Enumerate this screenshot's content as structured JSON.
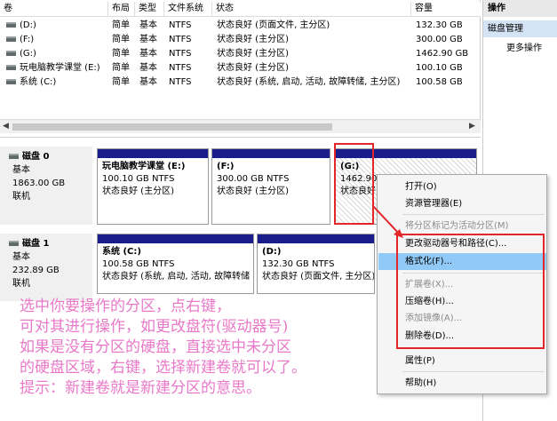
{
  "columns": [
    "卷",
    "布局",
    "类型",
    "文件系统",
    "状态",
    "容量"
  ],
  "volumes": [
    {
      "name": "(D:)",
      "layout": "简单",
      "type": "基本",
      "fs": "NTFS",
      "status": "状态良好 (页面文件, 主分区)",
      "capacity": "132.30 GB"
    },
    {
      "name": "(F:)",
      "layout": "简单",
      "type": "基本",
      "fs": "NTFS",
      "status": "状态良好 (主分区)",
      "capacity": "300.00 GB"
    },
    {
      "name": "(G:)",
      "layout": "简单",
      "type": "基本",
      "fs": "NTFS",
      "status": "状态良好 (主分区)",
      "capacity": "1462.90 GB"
    },
    {
      "name": "玩电脑教学课堂 (E:)",
      "layout": "简单",
      "type": "基本",
      "fs": "NTFS",
      "status": "状态良好 (主分区)",
      "capacity": "100.10 GB"
    },
    {
      "name": "系统 (C:)",
      "layout": "简单",
      "type": "基本",
      "fs": "NTFS",
      "status": "状态良好 (系统, 启动, 活动, 故障转储, 主分区)",
      "capacity": "100.58 GB"
    }
  ],
  "actions": {
    "title": "操作",
    "section": "磁盘管理",
    "more": "更多操作"
  },
  "disks": [
    {
      "name": "磁盘 0",
      "type": "基本",
      "size": "1863.00 GB",
      "state": "联机",
      "partitions": [
        {
          "label": "玩电脑教学课堂 (E:)",
          "size": "100.10 GB NTFS",
          "status": "状态良好 (主分区)"
        },
        {
          "label": "(F:)",
          "size": "300.00 GB NTFS",
          "status": "状态良好 (主分区)"
        },
        {
          "label": "(G:)",
          "size": "1462.90",
          "status": "状态良好"
        }
      ]
    },
    {
      "name": "磁盘 1",
      "type": "基本",
      "size": "232.89 GB",
      "state": "联机",
      "partitions": [
        {
          "label": "系统 (C:)",
          "size": "100.58 GB NTFS",
          "status": "状态良好 (系统, 启动, 活动, 故障转储"
        },
        {
          "label": "(D:)",
          "size": "132.30 GB NTFS",
          "status": "状态良好 (页面文件, 主分区)"
        }
      ]
    }
  ],
  "context_menu": [
    {
      "label": "打开(O)",
      "enabled": true
    },
    {
      "label": "资源管理器(E)",
      "enabled": true
    },
    {
      "label": "将分区标记为活动分区(M)",
      "enabled": false
    },
    {
      "label": "更改驱动器号和路径(C)...",
      "enabled": true
    },
    {
      "label": "格式化(F)...",
      "enabled": true,
      "highlighted": true
    },
    {
      "label": "扩展卷(X)...",
      "enabled": false
    },
    {
      "label": "压缩卷(H)...",
      "enabled": true
    },
    {
      "label": "添加镜像(A)...",
      "enabled": false
    },
    {
      "label": "删除卷(D)...",
      "enabled": true
    },
    {
      "label": "属性(P)",
      "enabled": true
    },
    {
      "label": "帮助(H)",
      "enabled": true
    }
  ],
  "annotation": {
    "lines": [
      "选中你要操作的分区，点右键，",
      "可对其进行操作，如更改盘符(驱动器号)",
      "如果是没有分区的硬盘，直接选中未分区",
      "的硬盘区域，右键，选择新建卷就可以了。",
      "提示：新建卷就是新建分区的意思。"
    ]
  },
  "colors": {
    "partition_bar": "#1c1d8c",
    "highlight": "#91c9f7",
    "annotation_box": "#e2262a",
    "annotation_text": "#e879c9"
  }
}
